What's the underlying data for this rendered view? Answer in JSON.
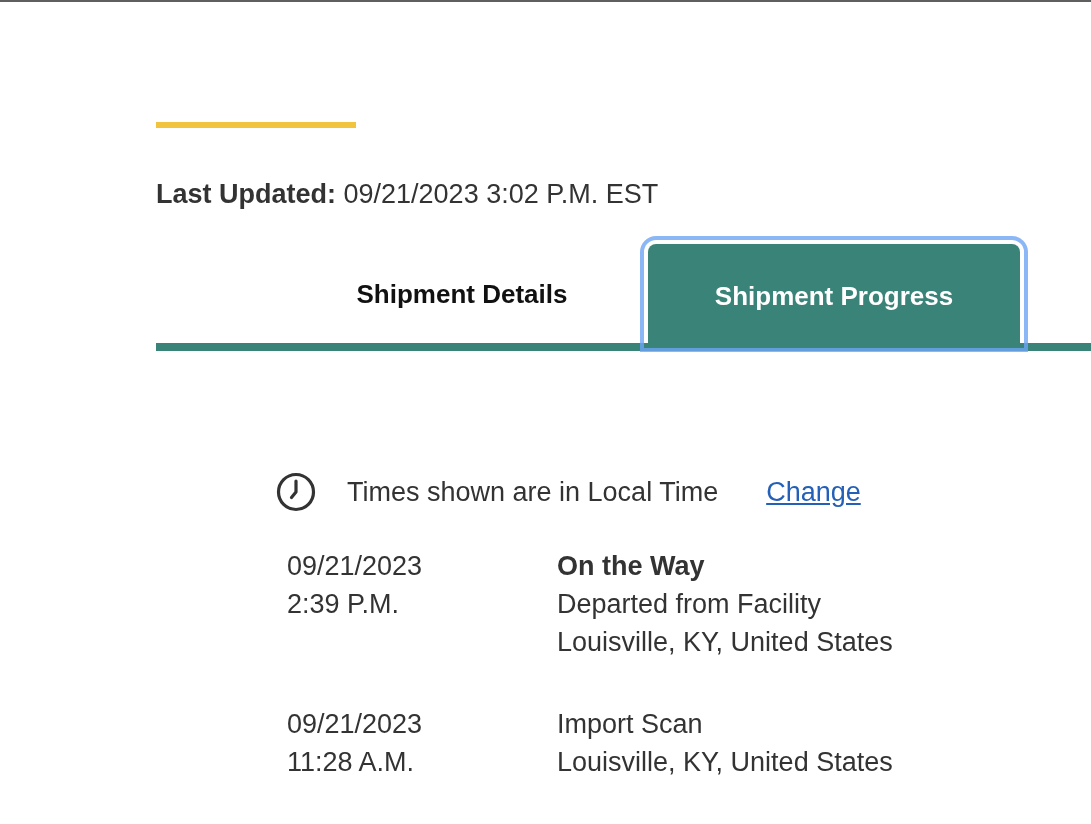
{
  "last_updated": "**Last Updated:** 09/21/2023 3:02 P.M. EST",
  "tabs": [
    {
      "label": "Shipment Details",
      "selected": false,
      "focused": false
    },
    {
      "label": "Shipment Progress",
      "selected": true,
      "focused": true
    }
  ],
  "timezone_note": {
    "text": "Times shown are in Local Time",
    "link": "Change"
  },
  "events": [
    {
      "date": "09/21/2023",
      "time": "2:39 P.M.",
      "status": "On the Way",
      "lines": [
        "Departed from Facility",
        "Louisville, KY, United States"
      ]
    },
    {
      "date": "09/21/2023",
      "time": "11:28 A.M.",
      "lines": [
        "Import Scan",
        "Louisville, KY, United States"
      ]
    }
  ]
}
